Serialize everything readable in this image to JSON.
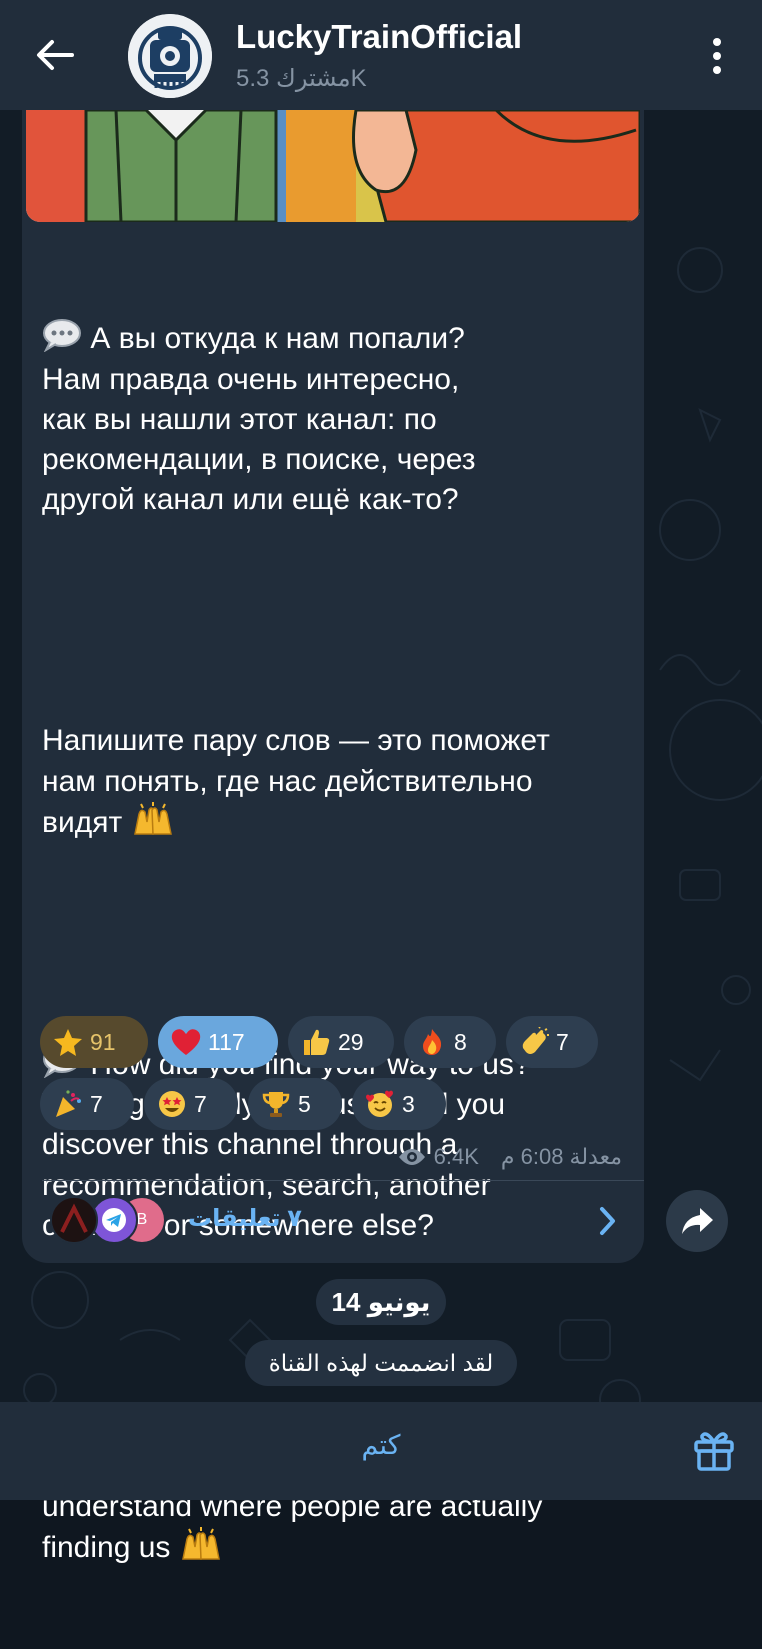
{
  "header": {
    "title": "LuckyTrainOfficial",
    "subtitle": "مشترك 5.3K"
  },
  "message": {
    "paragraphs_ru": [
      "А вы откуда к нам попали?\nНам правда очень интересно,\nкак вы нашли этот канал: по\nрекомендации, в поиске, через\nдругой канал или ещё как-то?",
      "Напишите пару слов — это поможет\nнам понять, где нас действительно\nвидят"
    ],
    "paragraphs_en": [
      "How did you find your way to us?\nWe’re genuinely curious — did you\ndiscover this channel through a\nrecommendation, search, another\nchannel, or somewhere else?",
      "Drop us a quick message — it’ll help us\nunderstand where people are actually\nfinding us"
    ],
    "reactions": [
      {
        "icon": "star-icon",
        "count": "91"
      },
      {
        "icon": "heart-icon",
        "count": "117"
      },
      {
        "icon": "thumbs-up-icon",
        "count": "29"
      },
      {
        "icon": "fire-icon",
        "count": "8"
      },
      {
        "icon": "clap-icon",
        "count": "7"
      },
      {
        "icon": "party-icon",
        "count": "7"
      },
      {
        "icon": "star-struck-icon",
        "count": "7"
      },
      {
        "icon": "trophy-icon",
        "count": "5"
      },
      {
        "icon": "smiling-hearts-icon",
        "count": "3"
      }
    ],
    "views": "6.4K",
    "time": "معدلة 6:08 م",
    "comments_label": "٧ تعليقات",
    "commenter_initial": "B"
  },
  "date_label": "14 يونيو",
  "joined_label": "لقد انضممت لهذه القناة",
  "bottom": {
    "mute_label": "كتم"
  },
  "colors": {
    "header_bg": "#212d3b",
    "bubble_bg": "#212d3b",
    "link": "#6ab3f3",
    "meta": "#8593a3",
    "heart_chip": "#6aa7dd",
    "star_chip": "#574a2d"
  }
}
